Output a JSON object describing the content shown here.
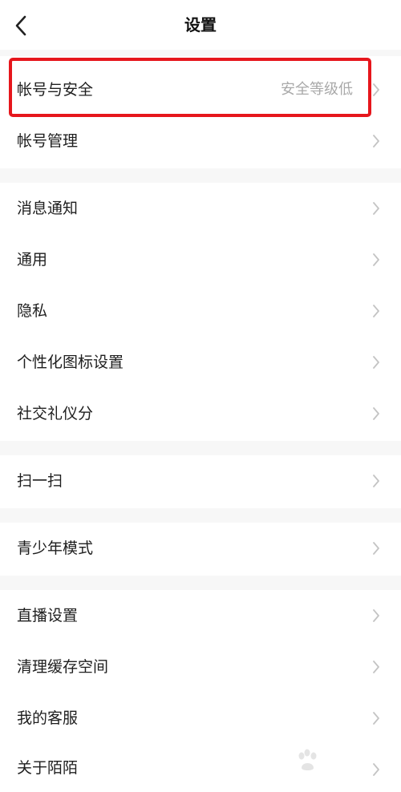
{
  "header": {
    "title": "设置",
    "back_icon": "chevron-left-icon"
  },
  "sections": [
    {
      "items": [
        {
          "label": "帐号与安全",
          "value": "安全等级低",
          "highlighted": true
        },
        {
          "label": "帐号管理"
        }
      ]
    },
    {
      "items": [
        {
          "label": "消息通知"
        },
        {
          "label": "通用"
        },
        {
          "label": "隐私"
        },
        {
          "label": "个性化图标设置"
        },
        {
          "label": "社交礼仪分"
        }
      ]
    },
    {
      "items": [
        {
          "label": "扫一扫"
        }
      ]
    },
    {
      "items": [
        {
          "label": "青少年模式"
        }
      ]
    },
    {
      "items": [
        {
          "label": "直播设置"
        },
        {
          "label": "清理缓存空间"
        },
        {
          "label": "我的客服"
        },
        {
          "label": "关于陌陌"
        }
      ]
    }
  ],
  "colors": {
    "highlight_border": "#e6161c",
    "secondary_text": "#a9a9a9",
    "chevron": "#c4c4c4"
  },
  "watermark": {
    "icon": "baidu-paw-icon"
  }
}
